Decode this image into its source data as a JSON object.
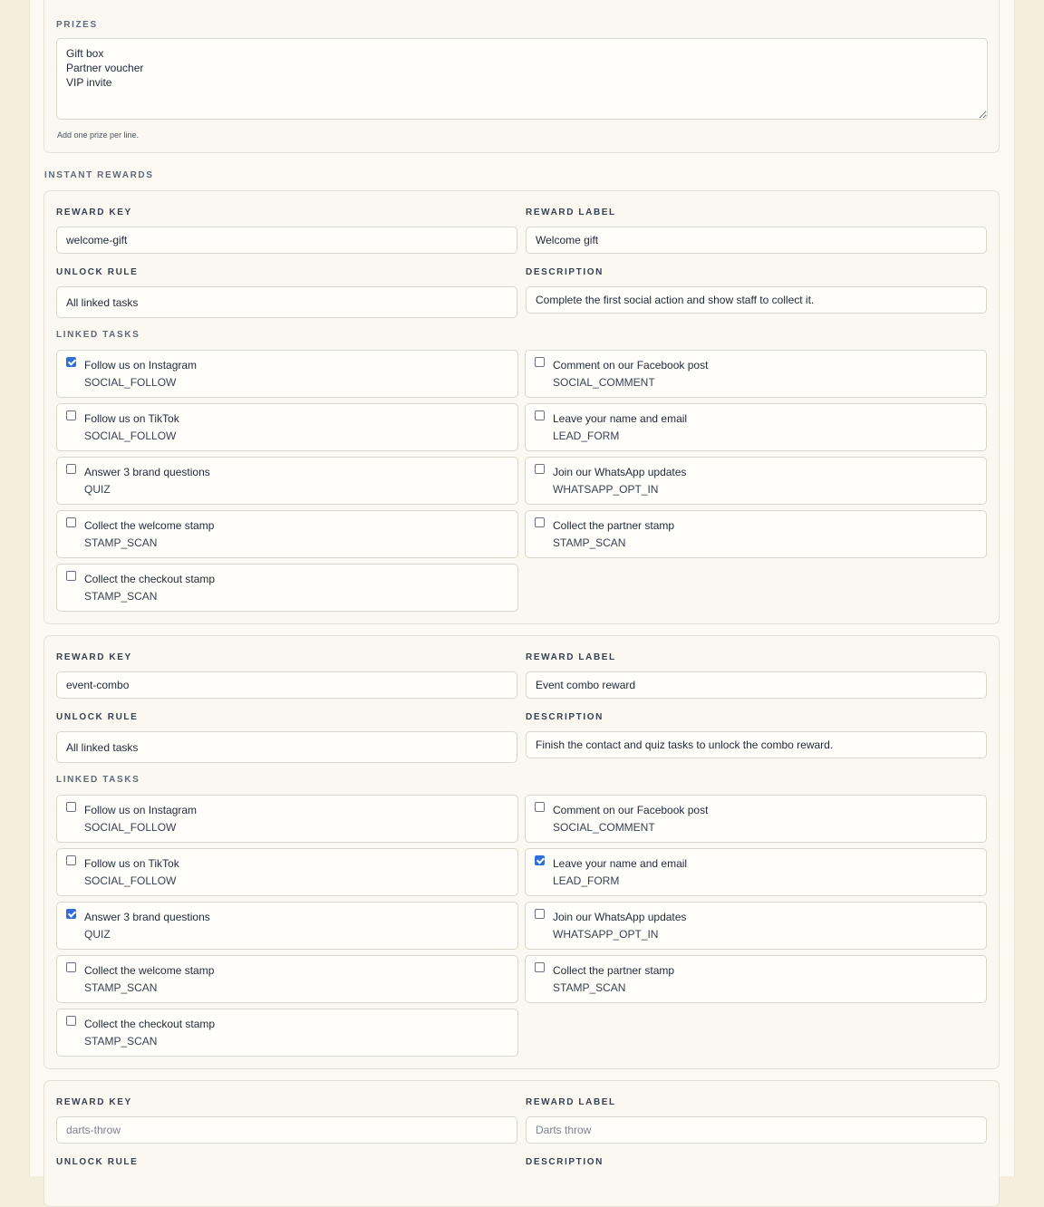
{
  "prizes": {
    "label": "PRIZES",
    "value": "Gift box\nPartner voucher\nVIP invite",
    "hint": "Add one prize per line."
  },
  "instant_rewards": {
    "title": "INSTANT REWARDS",
    "field_labels": {
      "key": "REWARD KEY",
      "label": "REWARD LABEL",
      "rule": "UNLOCK RULE",
      "description": "DESCRIPTION",
      "tasks": "LINKED TASKS"
    },
    "rewards": [
      {
        "key": "welcome-gift",
        "label": "Welcome gift",
        "rule": "All linked tasks",
        "description": "Complete the first social action and show staff to collect it.",
        "tasks": [
          {
            "label": "Follow us on Instagram",
            "type": "SOCIAL_FOLLOW",
            "checked": true
          },
          {
            "label": "Comment on our Facebook post",
            "type": "SOCIAL_COMMENT",
            "checked": false
          },
          {
            "label": "Follow us on TikTok",
            "type": "SOCIAL_FOLLOW",
            "checked": false
          },
          {
            "label": "Leave your name and email",
            "type": "LEAD_FORM",
            "checked": false
          },
          {
            "label": "Answer 3 brand questions",
            "type": "QUIZ",
            "checked": false
          },
          {
            "label": "Join our WhatsApp updates",
            "type": "WHATSAPP_OPT_IN",
            "checked": false
          },
          {
            "label": "Collect the welcome stamp",
            "type": "STAMP_SCAN",
            "checked": false
          },
          {
            "label": "Collect the partner stamp",
            "type": "STAMP_SCAN",
            "checked": false
          },
          {
            "label": "Collect the checkout stamp",
            "type": "STAMP_SCAN",
            "checked": false
          }
        ]
      },
      {
        "key": "event-combo",
        "label": "Event combo reward",
        "rule": "All linked tasks",
        "description": "Finish the contact and quiz tasks to unlock the combo reward.",
        "tasks": [
          {
            "label": "Follow us on Instagram",
            "type": "SOCIAL_FOLLOW",
            "checked": false
          },
          {
            "label": "Comment on our Facebook post",
            "type": "SOCIAL_COMMENT",
            "checked": false
          },
          {
            "label": "Follow us on TikTok",
            "type": "SOCIAL_FOLLOW",
            "checked": false
          },
          {
            "label": "Leave your name and email",
            "type": "LEAD_FORM",
            "checked": true
          },
          {
            "label": "Answer 3 brand questions",
            "type": "QUIZ",
            "checked": true
          },
          {
            "label": "Join our WhatsApp updates",
            "type": "WHATSAPP_OPT_IN",
            "checked": false
          },
          {
            "label": "Collect the welcome stamp",
            "type": "STAMP_SCAN",
            "checked": false
          },
          {
            "label": "Collect the partner stamp",
            "type": "STAMP_SCAN",
            "checked": false
          },
          {
            "label": "Collect the checkout stamp",
            "type": "STAMP_SCAN",
            "checked": false
          }
        ]
      },
      {
        "key_placeholder": "darts-throw",
        "label_placeholder": "Darts throw"
      }
    ]
  }
}
